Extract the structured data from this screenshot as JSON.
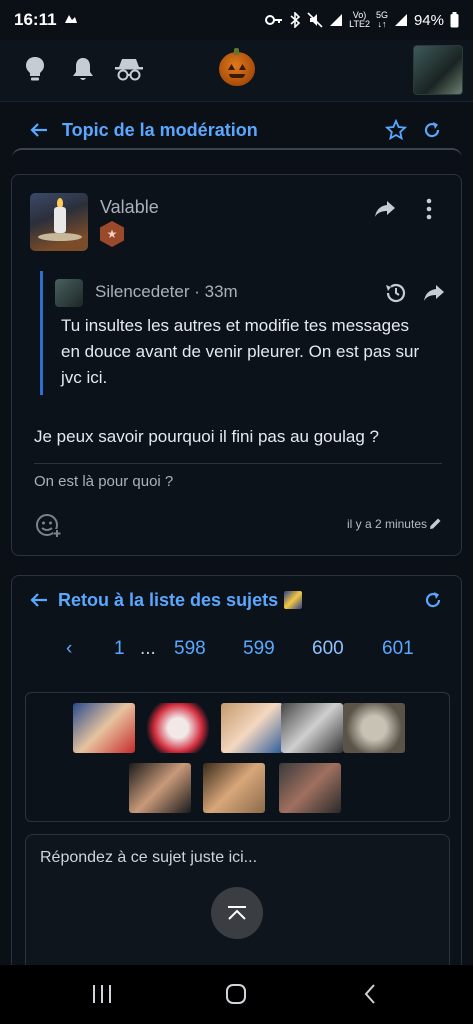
{
  "status": {
    "time": "16:11",
    "battery": "94%",
    "net_top": "Vo)",
    "net_bottom": "LTE2",
    "fiveg": "5G"
  },
  "topic": {
    "title": "Topic de la modération"
  },
  "post": {
    "author": "Valable",
    "quote": {
      "author": "Silencedeter",
      "time": "· 33m",
      "body": "Tu insultes les autres et modifie tes messages en douce avant de venir pleurer. On est pas sur jvc ici."
    },
    "body": "Je peux savoir pourquoi il fini pas au goulag ?",
    "signature": "On est là pour quoi ?",
    "timestamp": "il y a 2 minutes"
  },
  "bottom": {
    "back_label": "Retou à la liste des sujets",
    "pager": {
      "prev": "‹",
      "first": "1",
      "ellipsis": "...",
      "pages": [
        "598",
        "599",
        "600",
        "601"
      ],
      "current": "600"
    },
    "reply_placeholder": "Répondez à ce sujet juste ici..."
  },
  "colors": {
    "accent": "#5aa7ff",
    "background": "#0b1017",
    "badge": "#9a4a2a"
  },
  "icons": [
    "lightbulb-icon",
    "bell-icon",
    "incognito-icon",
    "arrow-left-icon",
    "star-icon",
    "refresh-icon",
    "share-icon",
    "more-icon",
    "history-icon",
    "add-reaction-icon",
    "pencil-icon",
    "chevron-up-icon"
  ]
}
